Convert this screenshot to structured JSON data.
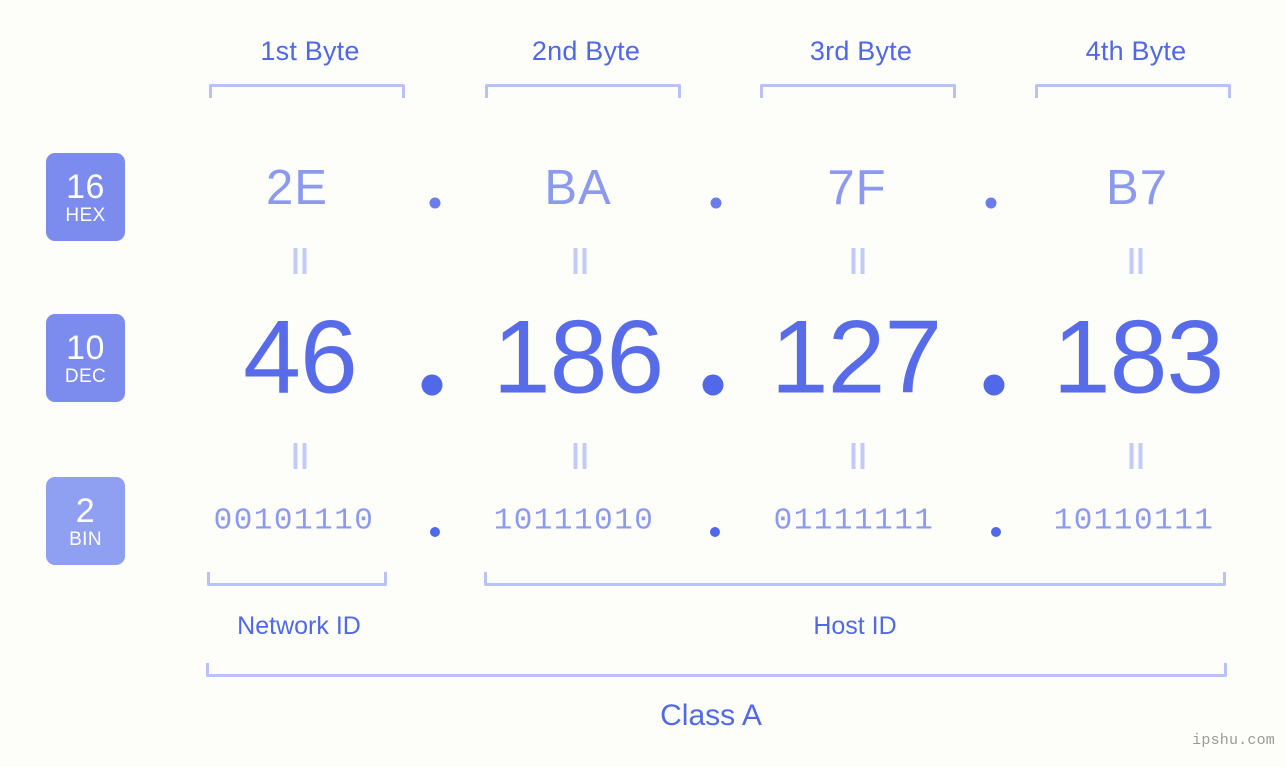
{
  "meta": {
    "background": "#fdfdfa",
    "accent_strong": "#586ce9",
    "accent_mid": "#8b99ef",
    "accent_light": "#b9c2f7",
    "badge_hex_color": "#7b8cee",
    "badge_dec_color": "#7b8cee",
    "badge_bin_color": "#8fa0f3"
  },
  "byte_headers": [
    {
      "label": "1st Byte"
    },
    {
      "label": "2nd Byte"
    },
    {
      "label": "3rd Byte"
    },
    {
      "label": "4th Byte"
    }
  ],
  "bases": [
    {
      "number": "16",
      "name": "HEX"
    },
    {
      "number": "10",
      "name": "DEC"
    },
    {
      "number": "2",
      "name": "BIN"
    }
  ],
  "rows": {
    "hex": {
      "values": [
        "2E",
        "BA",
        "7F",
        "B7"
      ],
      "separator": "."
    },
    "dec": {
      "values": [
        "46",
        "186",
        "127",
        "183"
      ],
      "separator": "."
    },
    "bin": {
      "values": [
        "00101110",
        "10111010",
        "01111111",
        "10110111"
      ],
      "separator": "."
    }
  },
  "equality_marks": {
    "symbol": "॥",
    "count_per_row": 4,
    "rows": 2
  },
  "sections": [
    {
      "label": "Network ID"
    },
    {
      "label": "Host ID"
    }
  ],
  "class": {
    "label": "Class A"
  },
  "watermark": {
    "text": "ipshu.com"
  },
  "ip_address": "46.186.127.183"
}
